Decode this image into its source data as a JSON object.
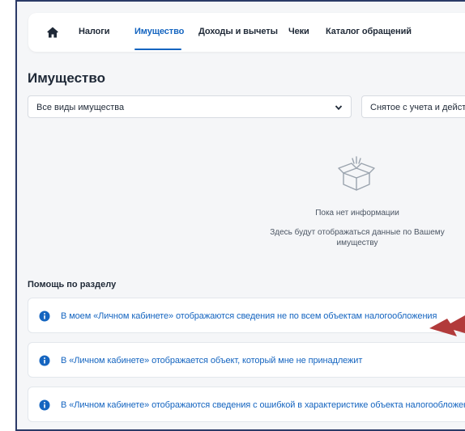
{
  "nav": {
    "items": [
      {
        "label": "Налоги",
        "active": false
      },
      {
        "label": "Имущество",
        "active": true
      },
      {
        "label": "Доходы и вычеты",
        "active": false
      },
      {
        "label": "Чеки",
        "active": false
      },
      {
        "label": "Каталог обращений",
        "active": false
      }
    ],
    "icons": {
      "home": "home-icon"
    }
  },
  "main": {
    "title": "Имущество",
    "filters": {
      "property_type": "Все виды имущества",
      "status": "Снятое с учета и действующее"
    }
  },
  "empty_state": {
    "icon": "empty-box-icon",
    "title": "Пока нет информации",
    "description": "Здесь будут отображаться данные по Вашему имуществу"
  },
  "help": {
    "title": "Помощь по разделу",
    "items": [
      "В моем «Личном кабинете» отображаются сведения не по всем объектам налогообложения",
      "В «Личном кабинете» отображается объект, который мне не принадлежит",
      "В «Личном кабинете» отображаются сведения с ошибкой в характеристике объекта налогообложения"
    ]
  },
  "colors": {
    "accent": "#1565c0",
    "background": "#f5f6f8",
    "annotation_arrow": "#b23b3b"
  }
}
